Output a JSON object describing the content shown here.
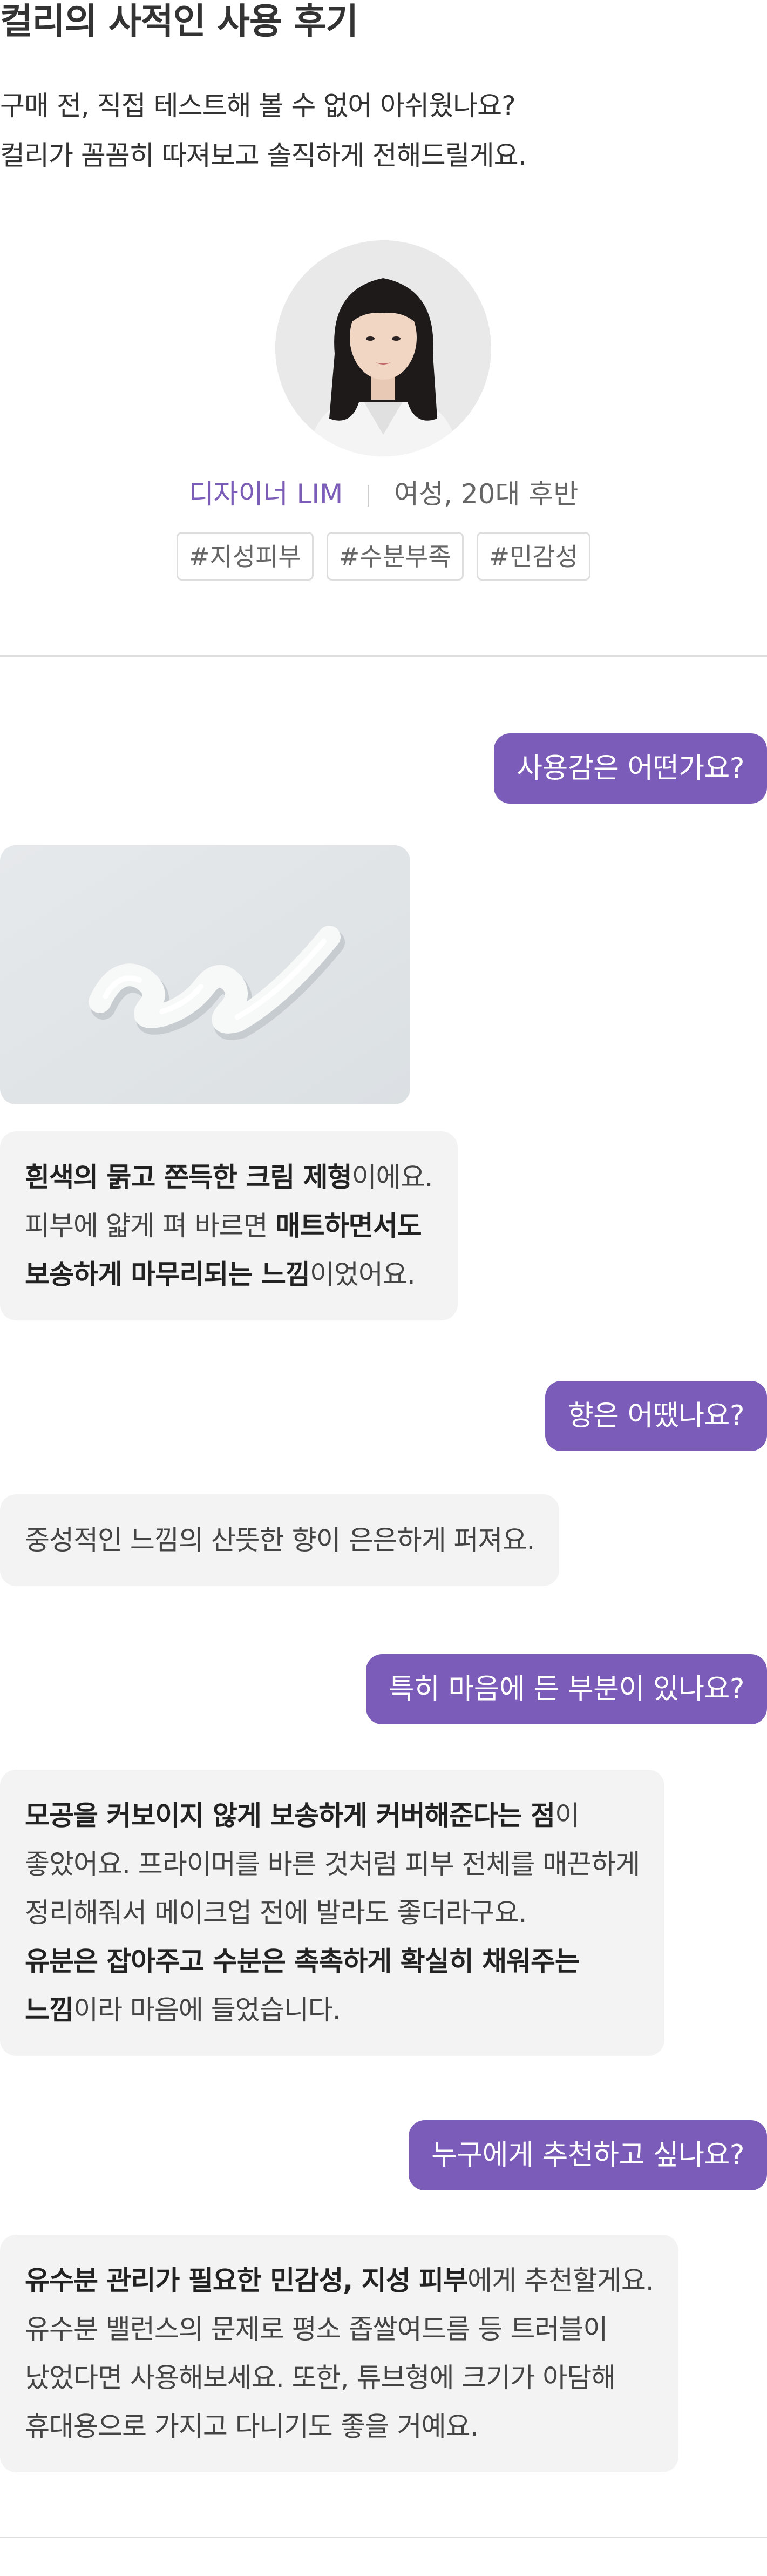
{
  "header": {
    "title": "컬리의 사적인 사용 후기",
    "intro_line1": "구매 전, 직접 테스트해 볼 수 없어 아쉬웠나요?",
    "intro_line2": "컬리가 꼼꼼히 따져보고 솔직하게 전해드릴게요."
  },
  "profile": {
    "name": "디자이너 LIM",
    "desc": "여성, 20대 후반",
    "tags": [
      "#지성피부",
      "#수분부족",
      "#민감성"
    ]
  },
  "qa": [
    {
      "question": "사용감은 어떤가요?",
      "answer_lines": [
        [
          {
            "t": "흰색의 묽고 쫀득한 크림 제형",
            "b": true
          },
          {
            "t": "이에요.",
            "b": false
          }
        ],
        [
          {
            "t": "피부에 얇게 펴 바르면 ",
            "b": false
          },
          {
            "t": "매트하면서도",
            "b": true
          }
        ],
        [
          {
            "t": "보송하게 마무리되는 느낌",
            "b": true
          },
          {
            "t": "이었어요.",
            "b": false
          }
        ]
      ]
    },
    {
      "question": "향은 어땠나요?",
      "answer_lines": [
        [
          {
            "t": "중성적인 느낌의 산뜻한 향이 은은하게 퍼져요.",
            "b": false
          }
        ]
      ]
    },
    {
      "question": "특히 마음에 든 부분이 있나요?",
      "answer_lines": [
        [
          {
            "t": "모공을 커보이지 않게 보송하게 커버해준다는 점",
            "b": true
          },
          {
            "t": "이",
            "b": false
          }
        ],
        [
          {
            "t": "좋았어요. 프라이머를 바른 것처럼 피부 전체를 매끈하게",
            "b": false
          }
        ],
        [
          {
            "t": "정리해줘서 메이크업 전에 발라도 좋더라구요.",
            "b": false
          }
        ],
        [
          {
            "t": "유분은 잡아주고 수분은 촉촉하게 확실히 채워주는",
            "b": true
          }
        ],
        [
          {
            "t": "느낌",
            "b": true
          },
          {
            "t": "이라 마음에 들었습니다.",
            "b": false
          }
        ]
      ]
    },
    {
      "question": "누구에게 추천하고 싶나요?",
      "answer_lines": [
        [
          {
            "t": "유수분 관리가 필요한 민감성, 지성 피부",
            "b": true
          },
          {
            "t": "에게 추천할게요.",
            "b": false
          }
        ],
        [
          {
            "t": "유수분 밸런스의 문제로 평소 좁쌀여드름 등 트러블이",
            "b": false
          }
        ],
        [
          {
            "t": "났었다면 사용해보세요. 또한, 튜브형에 크기가 아담해",
            "b": false
          }
        ],
        [
          {
            "t": "휴대용으로 가지고 다니기도 좋을 거예요.",
            "b": false
          }
        ]
      ]
    }
  ],
  "colors": {
    "accent": "#7b5cb8",
    "bubble_bg": "#f3f3f3",
    "divider": "#dddddd"
  }
}
